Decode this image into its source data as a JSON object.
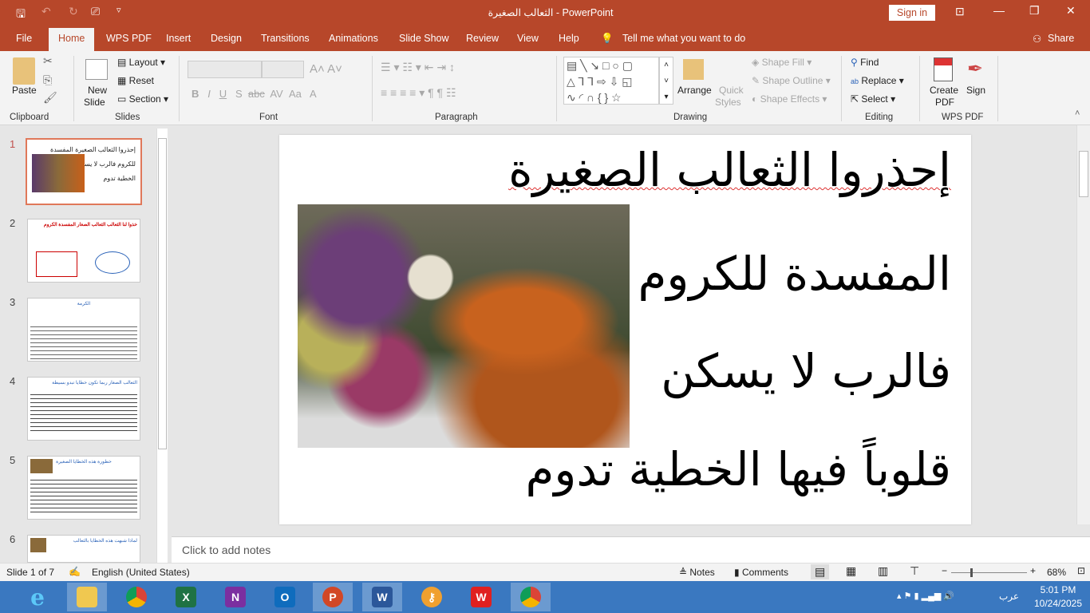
{
  "title": {
    "doc": "الثعالب الصغيرة",
    "sep": " - ",
    "app": "PowerPoint",
    "sign_in": "Sign in"
  },
  "tabs": [
    "File",
    "Home",
    "WPS PDF",
    "Insert",
    "Design",
    "Transitions",
    "Animations",
    "Slide Show",
    "Review",
    "View",
    "Help"
  ],
  "tell_me": "Tell me what you want to do",
  "share": "Share",
  "ribbon": {
    "clipboard": {
      "paste": "Paste",
      "label": "Clipboard"
    },
    "slides": {
      "new_slide": "New",
      "new_slide2": "Slide",
      "layout": "Layout",
      "reset": "Reset",
      "section": "Section",
      "label": "Slides"
    },
    "font": {
      "label": "Font",
      "bold": "B",
      "italic": "I",
      "underline": "U",
      "shadow": "S",
      "strike": "abc",
      "spacing": "AV",
      "case": "Aa",
      "color": "A"
    },
    "paragraph": {
      "label": "Paragraph"
    },
    "drawing": {
      "arrange": "Arrange",
      "quick": "Quick",
      "styles": "Styles",
      "fill": "Shape Fill",
      "outline": "Shape Outline",
      "effects": "Shape Effects",
      "label": "Drawing"
    },
    "editing": {
      "find": "Find",
      "replace": "Replace",
      "select": "Select",
      "label": "Editing"
    },
    "wps": {
      "create": "Create",
      "pdf": "PDF",
      "sign": "Sign",
      "label": "WPS PDF"
    }
  },
  "thumbnails": [
    {
      "n": "1",
      "text": "إحذروا الثعالب الصغيرة المفسدة للكروم فالرب لا يسكن قلوباً فيها الخطية تدوم"
    },
    {
      "n": "2",
      "text": "خذوا لنا الثعالب الثعالب الصغار المفسدة الكروم"
    },
    {
      "n": "3",
      "text": "الكرمة"
    },
    {
      "n": "4",
      "text": "الثعالب الصغار ربما تكون خطايا تبدو بسيطة"
    },
    {
      "n": "5",
      "text": "خطورة هذه الخطايا الصغيرة"
    },
    {
      "n": "6",
      "text": "لماذا شبهت هذه الخطايا بالثعالب"
    }
  ],
  "slide": {
    "lines": [
      "إحذروا الثعالب الصغيرة",
      "المفسدة للكروم",
      "فالرب لا يسكن",
      "قلوباً فيها الخطية تدوم"
    ]
  },
  "notes_placeholder": "Click to add notes",
  "status": {
    "slide": "Slide 1 of 7",
    "lang": "English (United States)",
    "notes": "Notes",
    "comments": "Comments",
    "zoom": "68%"
  },
  "tray": {
    "lang": "عرب",
    "time": "5:01 PM",
    "date": "10/24/2025"
  }
}
